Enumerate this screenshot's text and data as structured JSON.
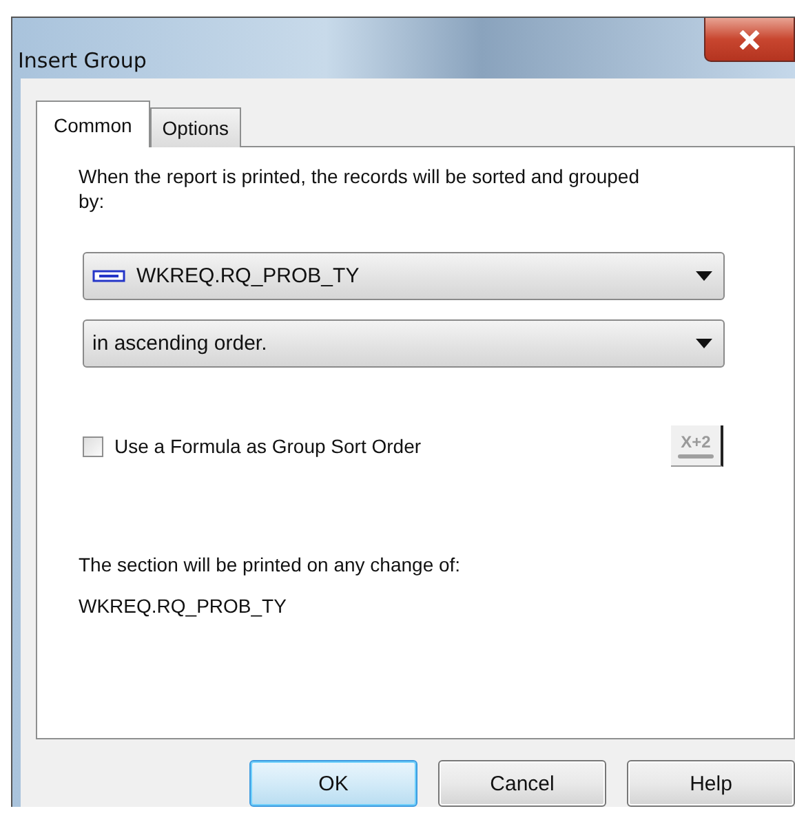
{
  "window": {
    "title": "Insert Group"
  },
  "tabs": [
    {
      "label": "Common",
      "selected": true
    },
    {
      "label": "Options",
      "selected": false
    }
  ],
  "description": "When the report is printed, the records will be sorted and grouped by:",
  "group_field": {
    "value": "WKREQ.RQ_PROB_TY"
  },
  "sort_order": {
    "value": "in ascending order."
  },
  "formula_option": {
    "label": "Use a Formula as Group Sort Order",
    "checked": false,
    "button_label": "X+2"
  },
  "section_note": {
    "label": "The section will be printed on any change of:",
    "value": "WKREQ.RQ_PROB_TY"
  },
  "buttons": [
    {
      "label": "OK",
      "default": true
    },
    {
      "label": "Cancel",
      "default": false
    },
    {
      "label": "Help",
      "default": false
    }
  ]
}
